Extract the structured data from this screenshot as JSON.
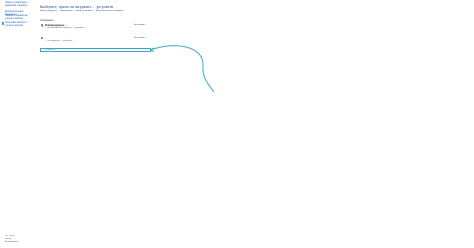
{
  "sidebar": {
    "items": [
      {
        "label": "Панель управления — домашняя страница"
      },
      {
        "label": "Дополнительные параметры"
      },
      {
        "label": "Изменить параметры учётных записей"
      },
      {
        "label": "Настройки контроля учётных записей"
      }
    ]
  },
  "main": {
    "title": "Выберите, нужно ли загружать ... устройств",
    "intro": "Нужно загружать ... приложения ... ваших устройств ... Дополнительные сведения",
    "intro_link": "Дополнительные сведения",
    "section_label": "Сохранение ...",
    "options": [
      {
        "label": "Рекомендуемые ...",
        "link": "Настройки ...",
        "description": "... автоматически загружать ... устройств ..."
      },
      {
        "label": "...",
        "link": "Настройки ...",
        "description": "... не загружать ... устройств ..."
      }
    ],
    "search_text": "... устройств"
  },
  "footer": {
    "lines": [
      "См. также",
      "Центр ...",
      "Безопасность ..."
    ]
  },
  "colors": {
    "accent": "#1a5fb4",
    "annotation": "#3ba9c9"
  }
}
